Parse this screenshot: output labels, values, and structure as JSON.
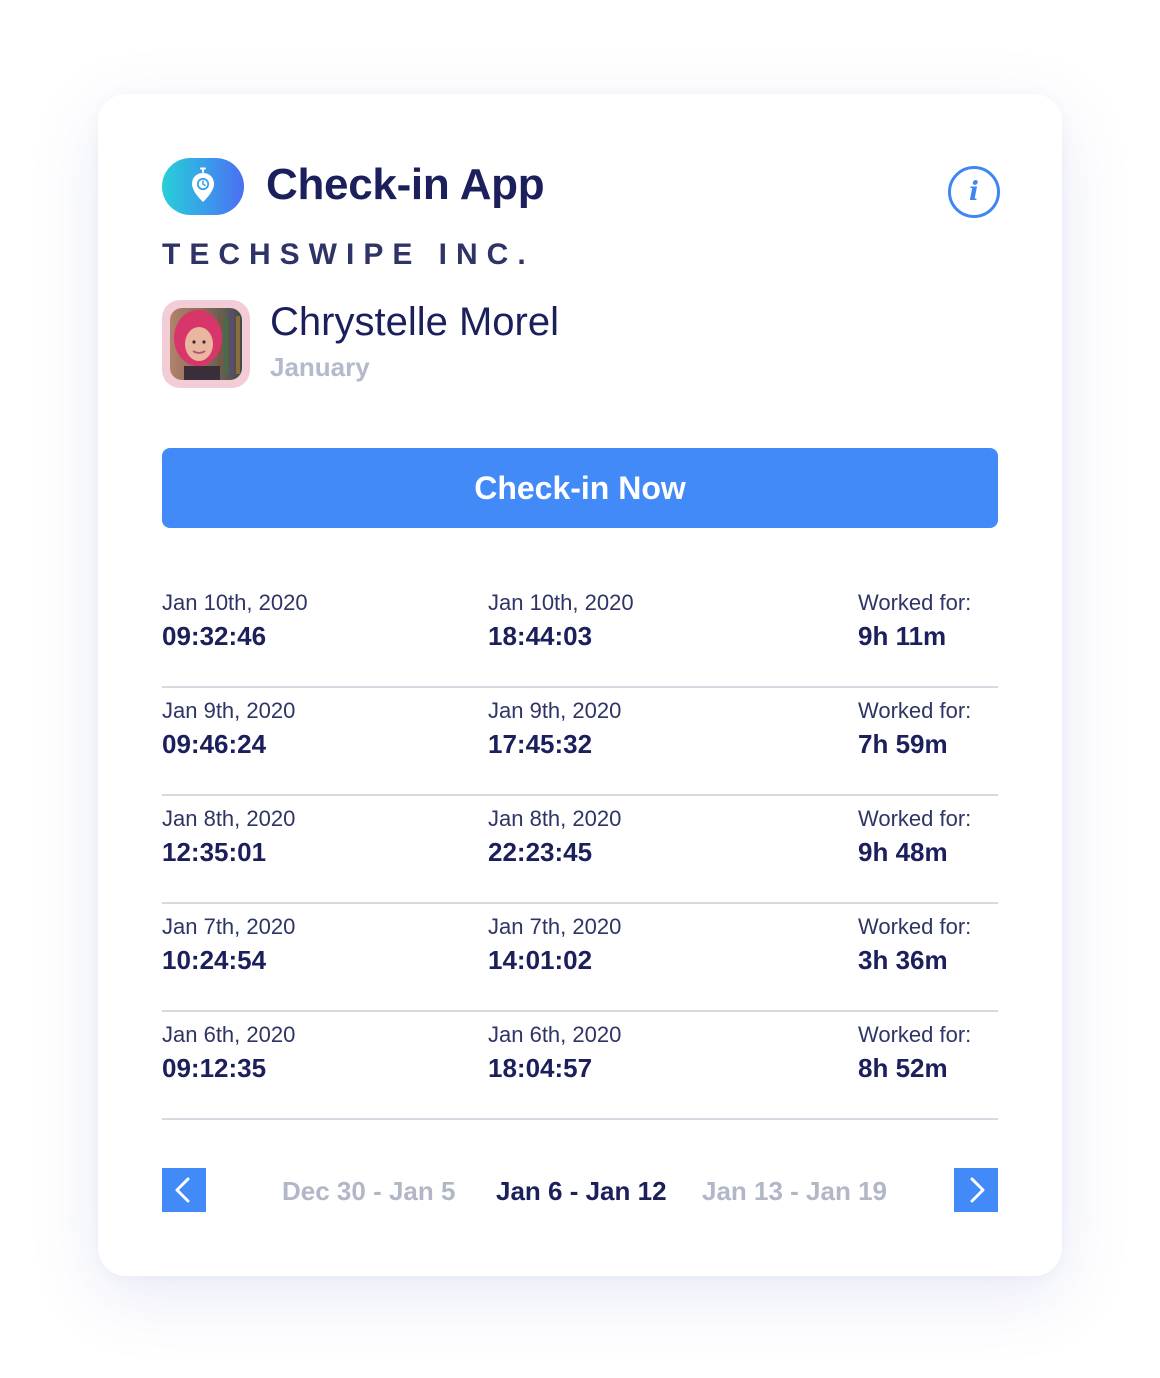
{
  "app": {
    "title": "Check-in App",
    "company": "TECHSWIPE INC.",
    "info_icon": "i",
    "accent_color": "#418af8",
    "title_color": "#1b1f5c"
  },
  "user": {
    "name": "Chrystelle Morel",
    "month": "January"
  },
  "checkin_button": "Check-in Now",
  "entries": [
    {
      "in_date": "Jan 10th, 2020",
      "in_time": "09:32:46",
      "out_date": "Jan 10th, 2020",
      "out_time": "18:44:03",
      "worked_label": "Worked for:",
      "worked": "9h 11m"
    },
    {
      "in_date": "Jan 9th, 2020",
      "in_time": "09:46:24",
      "out_date": "Jan 9th, 2020",
      "out_time": "17:45:32",
      "worked_label": "Worked for:",
      "worked": "7h 59m"
    },
    {
      "in_date": "Jan 8th, 2020",
      "in_time": "12:35:01",
      "out_date": "Jan 8th, 2020",
      "out_time": "22:23:45",
      "worked_label": "Worked for:",
      "worked": "9h 48m"
    },
    {
      "in_date": "Jan 7th, 2020",
      "in_time": "10:24:54",
      "out_date": "Jan 7th, 2020",
      "out_time": "14:01:02",
      "worked_label": "Worked for:",
      "worked": "3h 36m"
    },
    {
      "in_date": "Jan 6th, 2020",
      "in_time": "09:12:35",
      "out_date": "Jan 6th, 2020",
      "out_time": "18:04:57",
      "worked_label": "Worked for:",
      "worked": "8h 52m"
    }
  ],
  "pager": {
    "prev_icon": "chevron-left-icon",
    "next_icon": "chevron-right-icon",
    "prev_week": "Dec 30 - Jan 5",
    "current_week": "Jan 6 - Jan 12",
    "next_week": "Jan 13 - Jan 19"
  }
}
